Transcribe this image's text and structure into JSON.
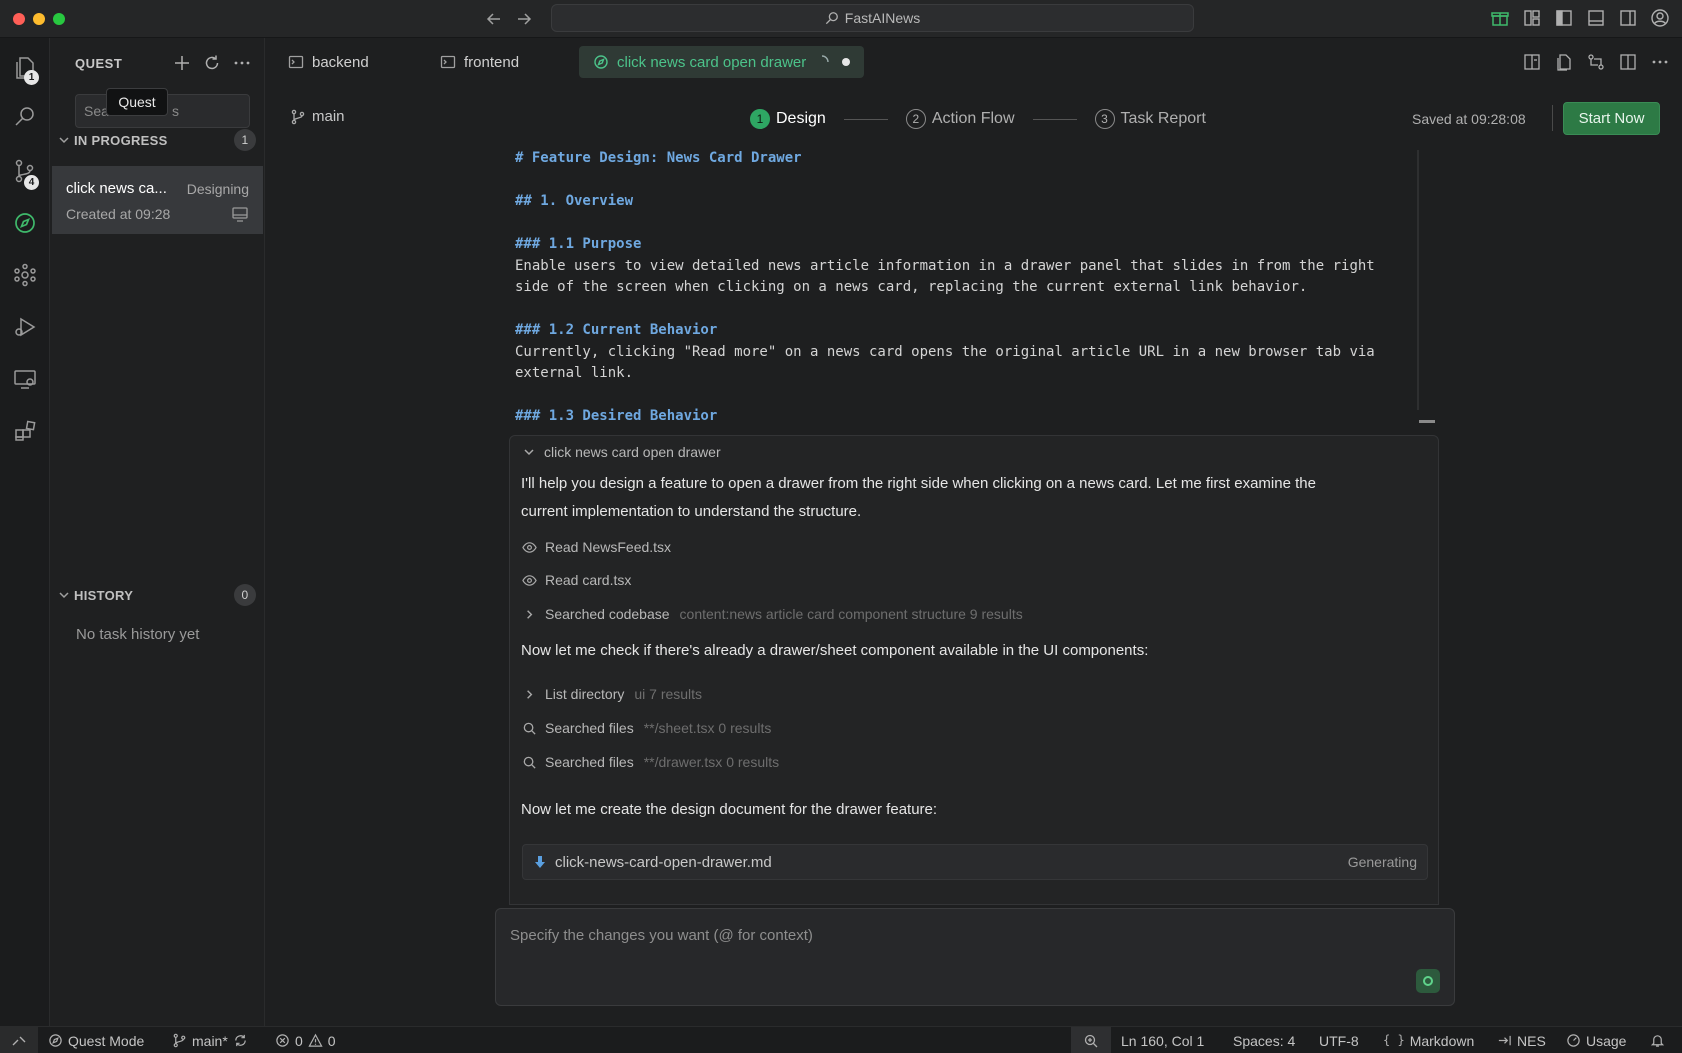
{
  "titlebar": {
    "search_text": "FastAINews"
  },
  "activity": {
    "explorer_badge": "1",
    "scm_badge": "4"
  },
  "sidebar": {
    "title": "QUEST",
    "search_placeholder": "Search tasks",
    "search_visible_start": "Sea",
    "search_visible_end": "s",
    "tooltip": "Quest",
    "in_progress": {
      "label": "IN PROGRESS",
      "count": "1"
    },
    "task": {
      "name": "click news ca...",
      "status": "Designing",
      "created": "Created at 09:28"
    },
    "history": {
      "label": "HISTORY",
      "count": "0",
      "empty": "No task history yet"
    }
  },
  "tabs": [
    {
      "label": "backend"
    },
    {
      "label": "frontend"
    },
    {
      "label": "click news card open drawer"
    }
  ],
  "toolbar": {
    "branch": "main",
    "steps": [
      {
        "num": "1",
        "label": "Design"
      },
      {
        "num": "2",
        "label": "Action Flow"
      },
      {
        "num": "3",
        "label": "Task Report"
      }
    ],
    "saved": "Saved at 09:28:08",
    "start_label": "Start Now"
  },
  "markdown": {
    "title": "# Feature Design: News Card Drawer",
    "h_overview": "## 1. Overview",
    "h_purpose": "### 1.1 Purpose",
    "purpose_l1": "Enable users to view detailed news article information in a drawer panel that slides in from the right",
    "purpose_l2": "side of the screen when clicking on a news card, replacing the current external link behavior.",
    "h_current": "### 1.2 Current Behavior",
    "current_l1": "Currently, clicking \"Read more\" on a news card opens the original article URL in a new browser tab via",
    "current_l2": "external link.",
    "h_desired": "### 1.3 Desired Behavior"
  },
  "chat": {
    "header": "click news card open drawer",
    "msg1_l1": "I'll help you design a feature to open a drawer from the right side when clicking on a news card. Let me first examine the",
    "msg1_l2": "current implementation to understand the structure.",
    "read1": "Read NewsFeed.tsx",
    "read2": "Read card.tsx",
    "search_codebase": {
      "label": "Searched codebase",
      "detail": "content:news article card component structure 9 results"
    },
    "msg2": "Now let me check if there's already a drawer/sheet component available in the UI components:",
    "list_dir": {
      "label": "List directory",
      "detail": "ui 7 results"
    },
    "search_sheet": {
      "label": "Searched files",
      "detail": "**/sheet.tsx 0 results"
    },
    "search_drawer": {
      "label": "Searched files",
      "detail": "**/drawer.tsx 0 results"
    },
    "msg3": "Now let me create the design document for the drawer feature:",
    "file": {
      "name": "click-news-card-open-drawer.md",
      "status": "Generating"
    }
  },
  "input": {
    "placeholder": "Specify the changes you want (@ for context)"
  },
  "status": {
    "mode": "Quest Mode",
    "branch": "main*",
    "errors": "0",
    "warnings": "0",
    "position": "Ln 160, Col 1",
    "spaces": "Spaces: 4",
    "encoding": "UTF-8",
    "language": "Markdown",
    "nes": "NES",
    "usage": "Usage"
  }
}
